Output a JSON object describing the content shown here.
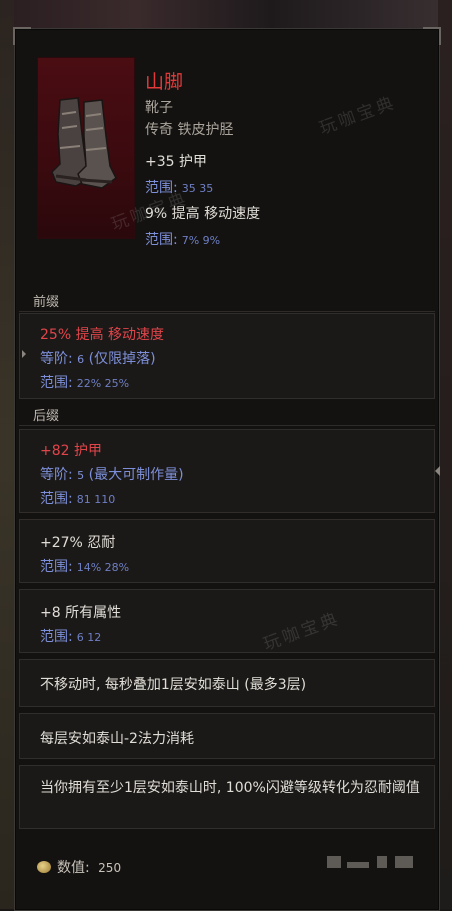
{
  "item": {
    "name": "山脚",
    "type": "靴子",
    "rarity_base": "传奇 铁皮护胫",
    "implicits": [
      {
        "stat": "+35 护甲",
        "range_label": "范围:",
        "range_vals": "35  35"
      },
      {
        "stat": "9% 提高 移动速度",
        "range_label": "范围:",
        "range_vals": "7%  9%"
      }
    ]
  },
  "sections": {
    "prefix_label": "前缀",
    "suffix_label": "后缀"
  },
  "prefix": {
    "stat": "25% 提高 移动速度",
    "tier_label": "等阶:",
    "tier_value": "6",
    "tier_note": "(仅限掉落)",
    "range_label": "范围:",
    "range_vals": "22%  25%"
  },
  "suffix": {
    "stat": "+82 护甲",
    "tier_label": "等阶:",
    "tier_value": "5",
    "tier_note": "(最大可制作量)",
    "range_label": "范围:",
    "range_vals": "81  110"
  },
  "uniques": [
    {
      "stat": "+27% 忍耐",
      "range_label": "范围:",
      "range_vals": "14%  28%"
    },
    {
      "stat": "+8 所有属性",
      "range_label": "范围:",
      "range_vals": "6  12"
    },
    {
      "stat": "不移动时, 每秒叠加1层安如泰山 (最多3层)"
    },
    {
      "stat": "每层安如泰山-2法力消耗"
    },
    {
      "stat": "当你拥有至少1层安如泰山时, 100%闪避等级转化为忍耐阈值"
    }
  ],
  "footer": {
    "value_label": "数值:",
    "value": "250"
  },
  "watermark": "玩咖宝典"
}
